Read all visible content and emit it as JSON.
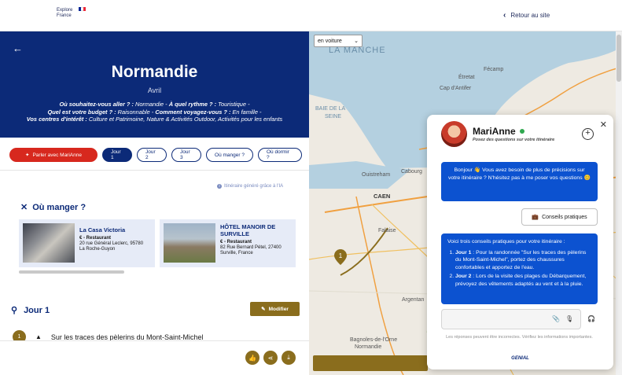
{
  "header": {
    "logo_line1": "Explore",
    "logo_line2": "France",
    "flag_colors": [
      "#002395",
      "#ffffff",
      "#ed2939"
    ],
    "back_label": "Retour au site"
  },
  "hero": {
    "title": "Normandie",
    "month": "Avril",
    "q1": "Où souhaitez-vous aller ? :",
    "a1": " Normandie - ",
    "q2": "À quel rythme ? :",
    "a2": " Touristique -",
    "q3": "Quel est votre budget ? :",
    "a3": " Raisonnable - ",
    "q4": "Comment voyagez-vous ? :",
    "a4": " En famille -",
    "q5": "Vos centres d'intérêt :",
    "a5": " Culture et Patrimoine, Nature & Activités Outdoor, Activités pour les enfants"
  },
  "tabs": {
    "mari": "Parler avec MariAnne",
    "items": [
      "Jour 1",
      "Jour 2",
      "Jour 3",
      "Où manger ?",
      "Où dormir ?"
    ]
  },
  "ia_note": "Itinéraire généré grâce à l'IA",
  "eat": {
    "title": "Où manger ?",
    "cards": [
      {
        "name": "La Casa Victoria",
        "category": "€ - Restaurant",
        "address1": "20 rue Général Leclerc, 95780",
        "address2": "La Roche-Guyon"
      },
      {
        "name": "HÔTEL MANOIR DE SURVILLE",
        "category": "€ - Restaurant",
        "address1": "82 Rue Bernard Pétel, 27400",
        "address2": "Surville, France"
      }
    ]
  },
  "day": {
    "title": "Jour 1",
    "modify_label": "Modifier",
    "step_number": "1",
    "step_title": "Sur les traces des pèlerins du Mont-Saint-Michel"
  },
  "map": {
    "mode": "en voiture",
    "labels": {
      "sea": "LA MANCHE",
      "bay1": "BAIE DE LA",
      "bay2": "SEINE",
      "caen": "CAEN",
      "fecamp": "Fécamp",
      "etretat": "Étretat",
      "capantifer": "Cap d'Antifer",
      "ouistreham": "Ouistreham",
      "cabourg": "Cabourg",
      "argentan": "Argentan",
      "bagnoles": "Bagnoles-de-l'Orne",
      "normandie": "Normandie",
      "falaise": "Falaise"
    },
    "marker": "1"
  },
  "chat": {
    "name": "MariAnne",
    "subtitle": "Posez des questions sur votre itinéraire",
    "message1": "Bonjour 👋 Vous avez besoin de plus de précisions sur votre itinéraire ? N'hésitez pas à me poser vos questions 😊",
    "quick_reply": "Conseils pratiques",
    "message2_intro": "Voici trois conseils pratiques pour votre itinéraire :",
    "tip1_label": "Jour 1",
    "tip1_text": " : Pour la randonnée \"Sur les traces des pèlerins du Mont-Saint-Michel\", portez des chaussures confortables et apportez de l'eau.",
    "tip2_label": "Jour 2",
    "tip2_text": " : Lors de la visite des plages du Débarquement, prévoyez des vêtements adaptés au vent et à la pluie.",
    "disclaimer": "Les réponses peuvent être incorrectes. Vérifiez les informations importantes.",
    "brand": "GENIAL"
  }
}
